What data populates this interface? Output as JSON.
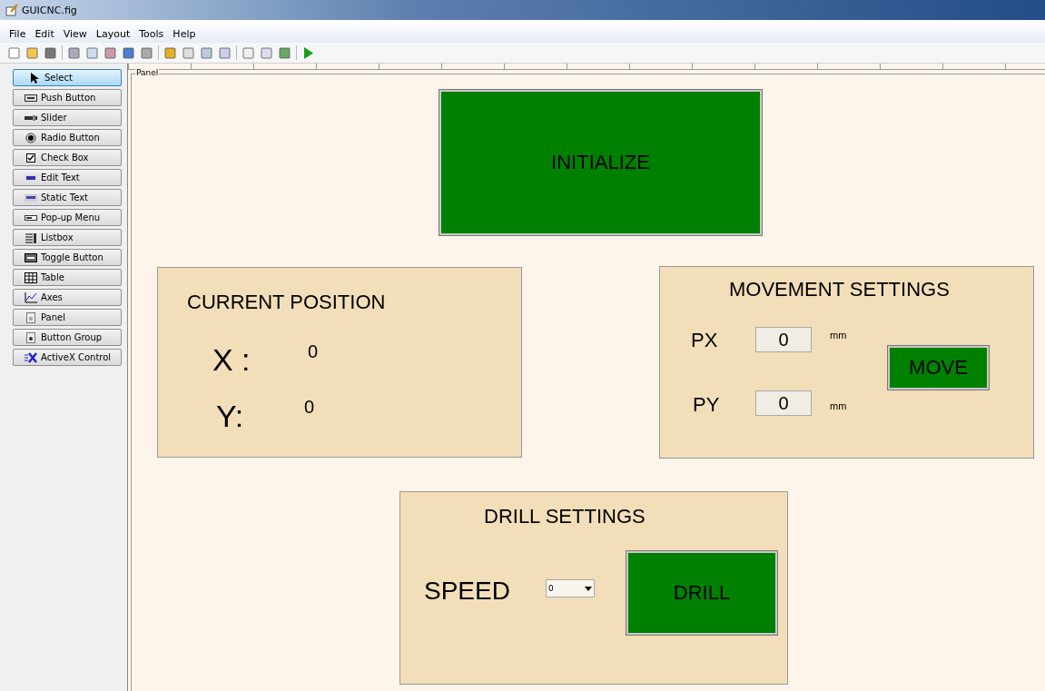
{
  "window": {
    "title": "GUICNC.fig"
  },
  "menu": [
    "File",
    "Edit",
    "View",
    "Layout",
    "Tools",
    "Help"
  ],
  "palette": [
    {
      "label": "Select",
      "kind": "select",
      "selected": true
    },
    {
      "label": "Push Button",
      "kind": "push",
      "selected": false
    },
    {
      "label": "Slider",
      "kind": "slider",
      "selected": false
    },
    {
      "label": "Radio Button",
      "kind": "radio",
      "selected": false
    },
    {
      "label": "Check Box",
      "kind": "check",
      "selected": false
    },
    {
      "label": "Edit Text",
      "kind": "edit",
      "selected": false
    },
    {
      "label": "Static Text",
      "kind": "static",
      "selected": false
    },
    {
      "label": "Pop-up Menu",
      "kind": "popup",
      "selected": false
    },
    {
      "label": "Listbox",
      "kind": "listbox",
      "selected": false
    },
    {
      "label": "Toggle Button",
      "kind": "toggle",
      "selected": false
    },
    {
      "label": "Table",
      "kind": "table",
      "selected": false
    },
    {
      "label": "Axes",
      "kind": "axes",
      "selected": false
    },
    {
      "label": "Panel",
      "kind": "panel",
      "selected": false
    },
    {
      "label": "Button Group",
      "kind": "group",
      "selected": false
    },
    {
      "label": "ActiveX Control",
      "kind": "activex",
      "selected": false
    }
  ],
  "canvas": {
    "panel_title": "Panel",
    "initialize_button": "INITIALIZE",
    "current_position": {
      "title": "CURRENT POSITION",
      "x_label": "X :",
      "x_value": "0",
      "y_label": "Y:",
      "y_value": "0"
    },
    "movement_settings": {
      "title": "MOVEMENT SETTINGS",
      "px_label": "PX",
      "px_value": "0",
      "px_unit": "mm",
      "py_label": "PY",
      "py_value": "0",
      "py_unit": "mm",
      "move_button": "MOVE"
    },
    "drill_settings": {
      "title": "DRILL SETTINGS",
      "speed_label": "SPEED",
      "speed_value": "0",
      "drill_button": "DRILL"
    }
  }
}
